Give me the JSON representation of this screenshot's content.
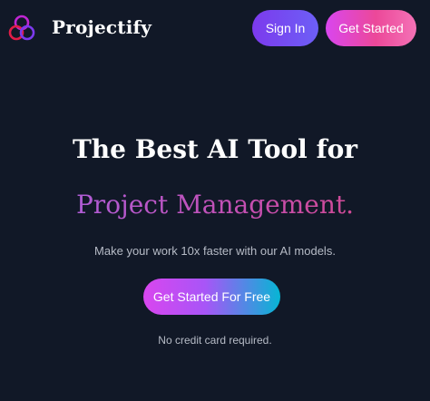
{
  "header": {
    "brand": "Projectify",
    "logo_icon": "overlapping-circles-logo-icon",
    "signin_label": "Sign In",
    "getstarted_label": "Get Started"
  },
  "hero": {
    "title_line1": "The Best AI Tool for",
    "title_line2": "Project Management.",
    "subtitle": "Make your work 10x faster with our AI models.",
    "cta_label": "Get Started For Free",
    "note": "No credit card required."
  },
  "colors": {
    "background": "#111827",
    "signin_button": "#7c3aed",
    "getstarted_button": "#ec4899",
    "gradient_text_start": "#b05cd6",
    "gradient_text_end": "#d04a96",
    "cta_start": "#d946ef",
    "cta_end": "#06b6d4"
  }
}
